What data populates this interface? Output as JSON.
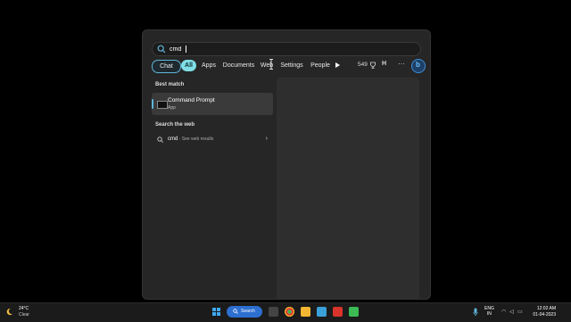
{
  "search": {
    "value": "cmd",
    "placeholder": ""
  },
  "filters": {
    "chat": "Chat",
    "all": "All",
    "apps": "Apps",
    "documents": "Documents",
    "web": "Web",
    "settings": "Settings",
    "people": "People",
    "points": "549",
    "profile_initial": "H",
    "more": "···"
  },
  "best_match": {
    "heading": "Best match",
    "title": "Command Prompt",
    "subtitle": "App"
  },
  "search_web": {
    "heading": "Search the web",
    "query": "cmd",
    "suffix": " - See web results"
  },
  "taskbar": {
    "temperature": "24°C",
    "condition": "Clear",
    "search_label": "Search",
    "lang_top": "ENG",
    "lang_bottom": "IN",
    "time": "12:02 AM",
    "date": "01-04-2023"
  },
  "colors": {
    "accent": "#5fb6d9",
    "all_chip": "#7fdde5",
    "taskbar_search": "#2d6fd0"
  }
}
